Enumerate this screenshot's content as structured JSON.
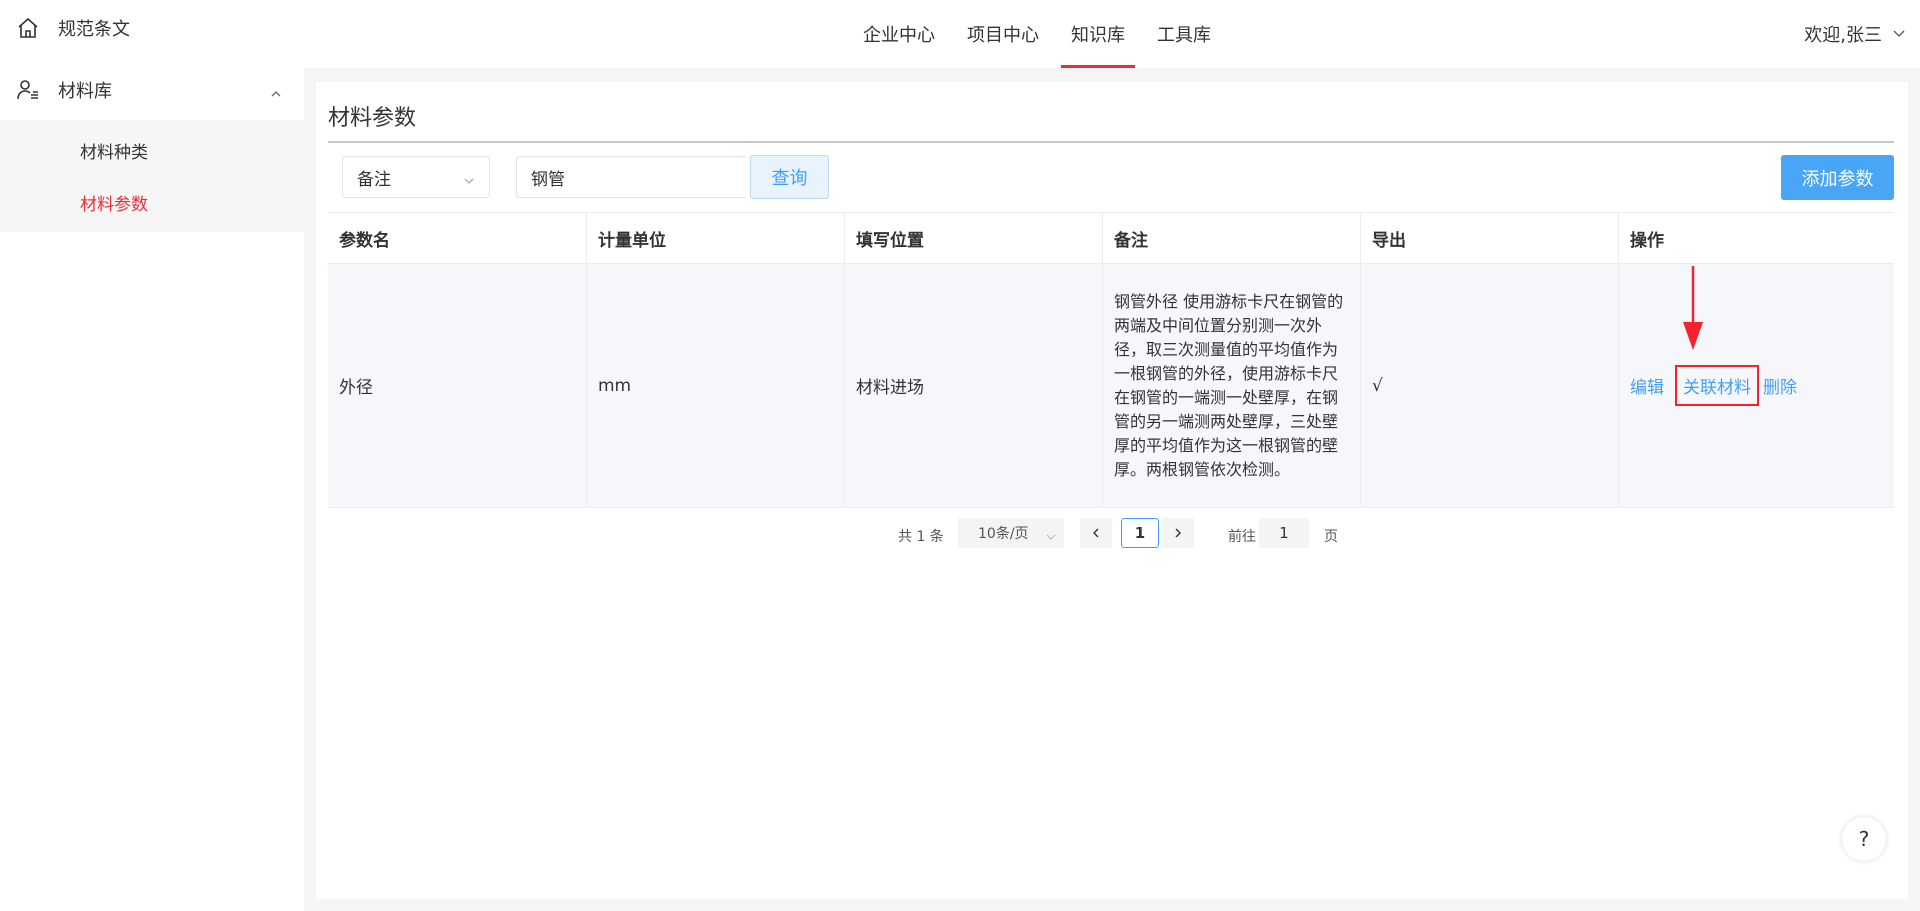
{
  "sidebar": {
    "items": [
      {
        "label": "规范条文",
        "icon": "home-icon"
      },
      {
        "label": "材料库",
        "icon": "user-list-icon",
        "expanded": true,
        "children": [
          {
            "label": "材料种类",
            "active": false
          },
          {
            "label": "材料参数",
            "active": true
          }
        ]
      }
    ]
  },
  "header": {
    "tabs": [
      {
        "label": "企业中心",
        "active": false
      },
      {
        "label": "项目中心",
        "active": false
      },
      {
        "label": "知识库",
        "active": true
      },
      {
        "label": "工具库",
        "active": false
      }
    ],
    "user": "欢迎,张三"
  },
  "main": {
    "title": "材料参数",
    "filter": {
      "field": "备注",
      "value": "钢管"
    },
    "query_label": "查询",
    "add_label": "添加参数",
    "table": {
      "columns": [
        "参数名",
        "计量单位",
        "填写位置",
        "备注",
        "导出",
        "操作"
      ],
      "rows": [
        {
          "name": "外径",
          "unit": "mm",
          "position": "材料进场",
          "note": "钢管外径 使用游标卡尺在钢管的两端及中间位置分别测一次外径，取三次测量值的平均值作为一根钢管的外径，使用游标卡尺在钢管的一端测一处壁厚，在钢管的另一端测两处壁厚，三处壁厚的平均值作为这一根钢管的壁厚。两根钢管依次检测。",
          "export": "√",
          "actions": {
            "edit": "编辑",
            "associate": "关联材料",
            "delete": "删除"
          }
        }
      ]
    },
    "pagination": {
      "total": "共 1 条",
      "page_size": "10条/页",
      "current": "1",
      "goto_label": "前往",
      "goto_value": "1",
      "page_label": "页"
    },
    "help": "?"
  },
  "colors": {
    "accent": "#409eff",
    "active_red": "#e8303c",
    "highlight_box": "#f5222d"
  }
}
